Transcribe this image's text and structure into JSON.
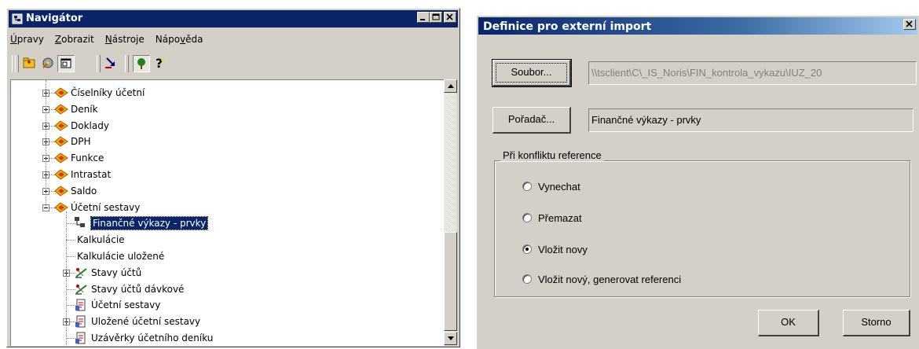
{
  "navigator": {
    "title": "Navigátor",
    "menu": [
      {
        "pre": "",
        "u": "Ú",
        "post": "pravy"
      },
      {
        "pre": "",
        "u": "Z",
        "post": "obrazit"
      },
      {
        "pre": "",
        "u": "N",
        "post": "ástroje"
      },
      {
        "pre": "Nápo",
        "u": "v",
        "post": "ěda"
      }
    ],
    "tree": [
      {
        "label": "Číselníky účetní",
        "expander": "plus",
        "icon": "folder-diamond-icon"
      },
      {
        "label": "Deník",
        "expander": "plus",
        "icon": "folder-diamond-icon"
      },
      {
        "label": "Doklady",
        "expander": "plus",
        "icon": "folder-diamond-icon"
      },
      {
        "label": "DPH",
        "expander": "plus",
        "icon": "folder-diamond-icon"
      },
      {
        "label": "Funkce",
        "expander": "plus",
        "icon": "folder-diamond-icon"
      },
      {
        "label": "Intrastat",
        "expander": "plus",
        "icon": "folder-diamond-icon"
      },
      {
        "label": "Saldo",
        "expander": "plus",
        "icon": "folder-diamond-icon"
      },
      {
        "label": "Účetní sestavy",
        "expander": "minus",
        "icon": "folder-diamond-icon"
      },
      {
        "label": "Finančné výkazy - prvky",
        "expander": "none",
        "icon": "hierarchy-icon",
        "selected": true
      },
      {
        "label": "Kalkulácie",
        "expander": "none",
        "icon": "none"
      },
      {
        "label": "Kalkulácie uložené",
        "expander": "none",
        "icon": "none"
      },
      {
        "label": "Stavy účtů",
        "expander": "plus",
        "icon": "scales-icon"
      },
      {
        "label": "Stavy účtů dávkové",
        "expander": "none",
        "icon": "scales-icon"
      },
      {
        "label": "Účetní sestavy",
        "expander": "none",
        "icon": "report-icon"
      },
      {
        "label": "Uložené účetní sestavy",
        "expander": "plus",
        "icon": "report-icon"
      },
      {
        "label": "Uzávěrky účetního deníku",
        "expander": "none",
        "icon": "report-icon"
      }
    ]
  },
  "dialog": {
    "title": "Definice pro externí import",
    "file_button": "Soubor...",
    "file_path": "\\\\tsclient\\C\\_IS_Noris\\FIN_kontrola_vykazu\\IUZ_20",
    "folder_button": "Pořadač...",
    "folder_value": "Finančné výkazy - prvky",
    "group_label": "Při konfliktu reference",
    "options": [
      "Vynechat",
      "Přemazat",
      "Vložit novy",
      "Vložit nový, generovat referenci"
    ],
    "selected_option": 2,
    "ok_button": "OK",
    "cancel_button": "Storno"
  },
  "colors": {
    "titlebar": "#0a246a",
    "face": "#d4d0c8",
    "selection": "#0a246a"
  }
}
